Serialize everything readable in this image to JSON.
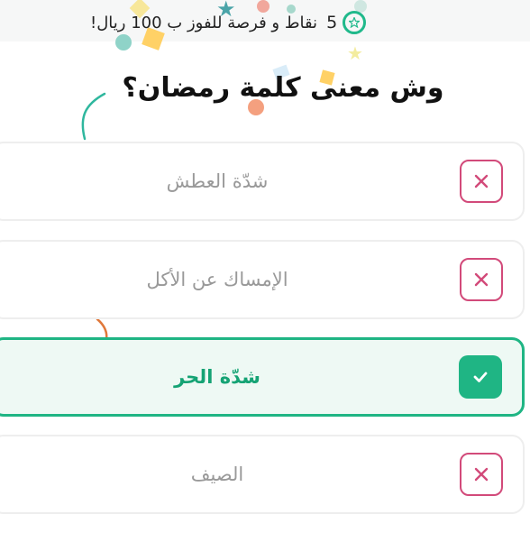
{
  "points": {
    "count": "5",
    "text": "نقاط و فرصة للفوز ب 100 ريال!"
  },
  "question": "وش معنى كلمة رمضان؟",
  "options": [
    {
      "label": "شدّة العطش",
      "state": "wrong",
      "icon": "x-icon"
    },
    {
      "label": "الإمساك عن الأكل",
      "state": "wrong",
      "icon": "x-icon"
    },
    {
      "label": "شدّة الحر",
      "state": "correct",
      "icon": "check-icon"
    },
    {
      "label": "الصيف",
      "state": "wrong",
      "icon": "x-icon"
    }
  ],
  "colors": {
    "accent": "#1fb584",
    "wrong": "#d24a7a",
    "correct_bg": "#eef9f4"
  }
}
